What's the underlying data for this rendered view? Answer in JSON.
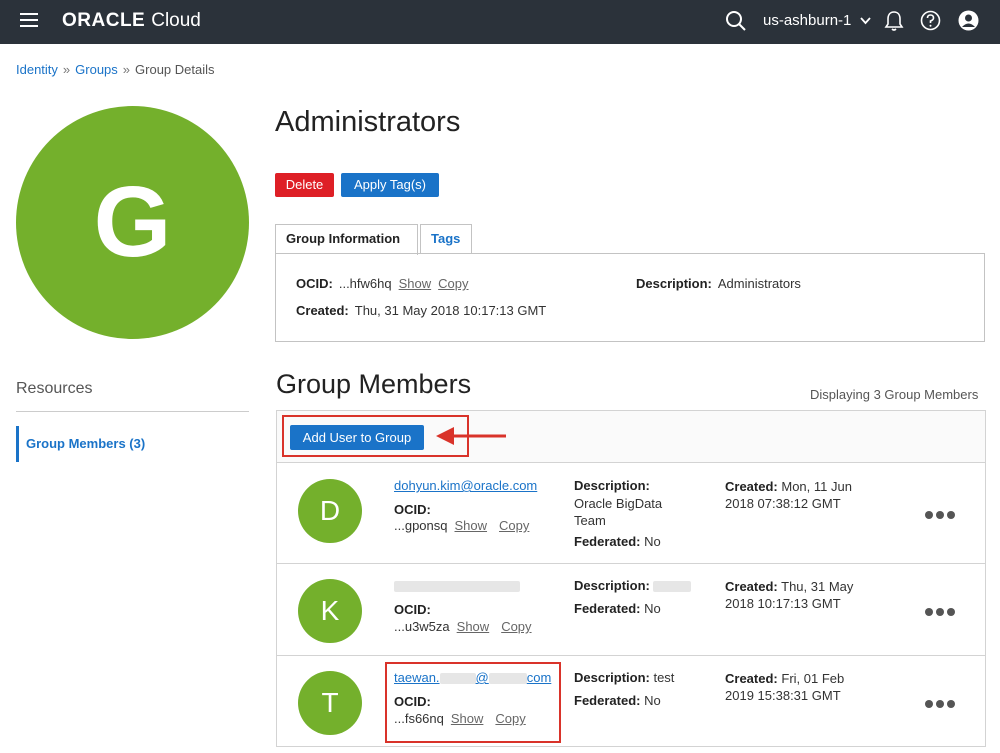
{
  "header": {
    "logo_oracle": "ORACLE",
    "logo_cloud": "Cloud",
    "region": "us-ashburn-1",
    "icons": [
      "menu-icon",
      "search-icon",
      "chevron-down-icon",
      "bell-icon",
      "help-icon",
      "user-icon"
    ]
  },
  "breadcrumb": {
    "items": [
      "Identity",
      "Groups",
      "Group Details"
    ],
    "separator": "»"
  },
  "group": {
    "initial": "G",
    "name": "Administrators",
    "delete_label": "Delete",
    "apply_tags_label": "Apply Tag(s)"
  },
  "tabs": [
    "Group Information",
    "Tags"
  ],
  "info": {
    "ocid_label": "OCID:",
    "ocid_value": "...hfw6hq",
    "show_label": "Show",
    "copy_label": "Copy",
    "created_label": "Created:",
    "created_value": "Thu, 31 May 2018 10:17:13 GMT",
    "description_label": "Description:",
    "description_value": "Administrators"
  },
  "resources": {
    "title": "Resources",
    "items": [
      "Group Members (3)"
    ]
  },
  "members_section": {
    "title": "Group Members",
    "count_text": "Displaying 3 Group Members",
    "add_button_label": "Add User to Group"
  },
  "members": [
    {
      "initial": "D",
      "email": "dohyun.kim@oracle.com",
      "ocid_label": "OCID:",
      "ocid_value": "...gponsq",
      "show_label": "Show",
      "copy_label": "Copy",
      "description_label": "Description:",
      "description_value": "Oracle BigData Team",
      "federated_label": "Federated:",
      "federated_value": "No",
      "created_label": "Created:",
      "created_value": "Mon, 11 Jun 2018 07:38:12 GMT"
    },
    {
      "initial": "K",
      "email": "",
      "ocid_label": "OCID:",
      "ocid_value": "...u3w5za",
      "show_label": "Show",
      "copy_label": "Copy",
      "description_label": "Description:",
      "description_value": "",
      "federated_label": "Federated:",
      "federated_value": "No",
      "created_label": "Created:",
      "created_value": "Thu, 31 May 2018 10:17:13 GMT"
    },
    {
      "initial": "T",
      "email_prefix": "taewan.",
      "email_at": "@",
      "email_suffix": "com",
      "ocid_label": "OCID:",
      "ocid_value": "...fs66nq",
      "show_label": "Show",
      "copy_label": "Copy",
      "description_label": "Description:",
      "description_value": "test",
      "federated_label": "Federated:",
      "federated_value": "No",
      "created_label": "Created:",
      "created_value": "Fri, 01 Feb 2019 15:38:31 GMT"
    }
  ],
  "colors": {
    "topbar": "#2b323a",
    "accent": "#1a73c8",
    "danger": "#de1f26",
    "avatar": "#74b02c",
    "highlight": "#d9332a"
  }
}
